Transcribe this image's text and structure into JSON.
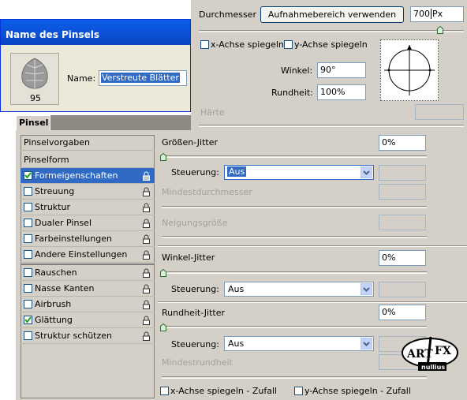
{
  "brush_name_dialog": {
    "title": "Name des Pinsels",
    "brush_size": "95",
    "name_label": "Name:",
    "name_value": "Verstreute Blätter"
  },
  "tip_shape": {
    "diameter_label": "Durchmesser",
    "sample_button": "Aufnahmebereich verwenden",
    "diameter_value": "700",
    "diameter_unit": "Px",
    "flip_x": "x-Achse spiegeln",
    "flip_y": "y-Achse spiegeln",
    "angle_label": "Winkel:",
    "angle_value": "90°",
    "roundness_label": "Rundheit:",
    "roundness_value": "100%",
    "hardness_label": "Härte"
  },
  "panel": {
    "tab": "Pinsel"
  },
  "sidebar": {
    "presets": "Pinselvorgaben",
    "tip_shape": "Pinselform",
    "items": [
      {
        "label": "Formeigenschaften",
        "checked": true,
        "selected": true
      },
      {
        "label": "Streuung",
        "checked": false
      },
      {
        "label": "Struktur",
        "checked": false
      },
      {
        "label": "Dualer Pinsel",
        "checked": false
      },
      {
        "label": "Farbeinstellungen",
        "checked": false
      },
      {
        "label": "Andere Einstellungen",
        "checked": false
      },
      {
        "label": "Rauschen",
        "checked": false
      },
      {
        "label": "Nasse Kanten",
        "checked": false
      },
      {
        "label": "Airbrush",
        "checked": false
      },
      {
        "label": "Glättung",
        "checked": true
      },
      {
        "label": "Struktur schützen",
        "checked": false
      }
    ]
  },
  "shape_dynamics": {
    "size_jitter_label": "Größen-Jitter",
    "size_jitter_value": "0%",
    "control_label": "Steuerung:",
    "control_value": "Aus",
    "min_diameter_label": "Mindestdurchmesser",
    "tilt_scale_label": "Neigungsgröße",
    "angle_jitter_label": "Winkel-Jitter",
    "angle_jitter_value": "0%",
    "roundness_jitter_label": "Rundheit-Jitter",
    "roundness_jitter_value": "0%",
    "min_roundness_label": "Mindestrundheit",
    "flip_x_jitter": "x-Achse spiegeln - Zufall",
    "flip_y_jitter": "y-Achse spiegeln - Zufall"
  },
  "watermark": {
    "text": "ART i FX",
    "sub": "nullius"
  }
}
